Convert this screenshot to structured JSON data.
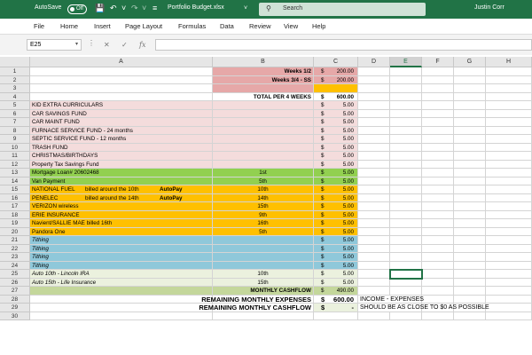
{
  "titlebar": {
    "autosave_label": "AutoSave",
    "autosave_state": "Off",
    "filename": "Portfolio Budget.xlsx",
    "search_label": "Search",
    "user": "Justin Corr"
  },
  "menu": [
    "File",
    "Home",
    "Insert",
    "Page Layout",
    "Formulas",
    "Data",
    "Review",
    "View",
    "Help"
  ],
  "formula_bar": {
    "name_box": "E25",
    "formula": ""
  },
  "columns": [
    "A",
    "B",
    "C",
    "D",
    "E",
    "F",
    "G",
    "H"
  ],
  "colors": {
    "header_red": "#e6a8a8",
    "pink": "#f4dcdc",
    "green": "#92d050",
    "orange": "#ffc000",
    "blue": "#8fc8da",
    "light_green": "#ebf1de",
    "olive": "#c4d79b",
    "excel_green": "#217346"
  },
  "rows": [
    {
      "n": "1",
      "a": "",
      "b": "Weeks 1/2",
      "c_dol": "$",
      "c_amt": "200.00",
      "style": "header"
    },
    {
      "n": "2",
      "a": "",
      "b": "Weeks 3/4 - SS",
      "c_dol": "$",
      "c_amt": "200.00",
      "style": "header"
    },
    {
      "n": "3",
      "a": "",
      "b": "",
      "c_dol": "",
      "c_amt": "",
      "style": "header_hidden"
    },
    {
      "n": "4",
      "a": "",
      "b": "TOTAL PER 4 WEEKS",
      "c_dol": "$",
      "c_amt": "600.00",
      "style": "total"
    },
    {
      "n": "5",
      "a": "KID EXTRA CURRICULARS",
      "b": "",
      "c_dol": "$",
      "c_amt": "5.00",
      "style": "pink"
    },
    {
      "n": "6",
      "a": "CAR SAVINGS FUND",
      "b": "",
      "c_dol": "$",
      "c_amt": "5.00",
      "style": "pink"
    },
    {
      "n": "7",
      "a": "CAR MAINT FUND",
      "b": "",
      "c_dol": "$",
      "c_amt": "5.00",
      "style": "pink"
    },
    {
      "n": "8",
      "a": "FURNACE SERVICE FUND - 24 months",
      "b": "",
      "c_dol": "$",
      "c_amt": "5.00",
      "style": "pink"
    },
    {
      "n": "9",
      "a": "SEPTIC SERVICE FUND - 12 months",
      "b": "",
      "c_dol": "$",
      "c_amt": "5.00",
      "style": "pink"
    },
    {
      "n": "10",
      "a": "TRASH FUND",
      "b": "",
      "c_dol": "$",
      "c_amt": "5.00",
      "style": "pink"
    },
    {
      "n": "11",
      "a": "CHRISTMAS/BIRTHDAYS",
      "b": "",
      "c_dol": "$",
      "c_amt": "5.00",
      "style": "pink"
    },
    {
      "n": "12",
      "a": "Property Tax Savings Fund",
      "b": "",
      "c_dol": "$",
      "c_amt": "5.00",
      "style": "pink"
    },
    {
      "n": "13",
      "a": "Mortgage    Loan# 20602468",
      "b": "1st",
      "c_dol": "$",
      "c_amt": "5.00",
      "style": "green"
    },
    {
      "n": "14",
      "a": "Van Payment",
      "b": "5th",
      "c_dol": "$",
      "c_amt": "5.00",
      "style": "green"
    },
    {
      "n": "15",
      "a": "NATIONAL FUEL",
      "a2": "billed around the 10th",
      "a3": "AutoPay",
      "b": "10th",
      "c_dol": "$",
      "c_amt": "5.00",
      "style": "orange"
    },
    {
      "n": "16",
      "a": "PENELEC",
      "a2": "billed around the 14th",
      "a3": "AutoPay",
      "b": "14th",
      "c_dol": "$",
      "c_amt": "5.00",
      "style": "orange"
    },
    {
      "n": "17",
      "a": "VERIZON wireless",
      "b": "15th",
      "c_dol": "$",
      "c_amt": "5.00",
      "style": "orange"
    },
    {
      "n": "18",
      "a": "ERIE INSURANCE",
      "b": "9th",
      "c_dol": "$",
      "c_amt": "5.00",
      "style": "orange"
    },
    {
      "n": "19",
      "a": "Navient/SALLIE MAE  billed 16th",
      "b": "16th",
      "c_dol": "$",
      "c_amt": "5.00",
      "style": "orange"
    },
    {
      "n": "20",
      "a": "Pandora One",
      "b": "5th",
      "c_dol": "$",
      "c_amt": "5.00",
      "style": "orange"
    },
    {
      "n": "21",
      "a": "Tithing",
      "b": "",
      "c_dol": "$",
      "c_amt": "5.00",
      "style": "blue"
    },
    {
      "n": "22",
      "a": "Tithing",
      "b": "",
      "c_dol": "$",
      "c_amt": "5.00",
      "style": "blue"
    },
    {
      "n": "23",
      "a": "Tithing",
      "b": "",
      "c_dol": "$",
      "c_amt": "5.00",
      "style": "blue"
    },
    {
      "n": "24",
      "a": "Tithing",
      "b": "",
      "c_dol": "$",
      "c_amt": "5.00",
      "style": "blue"
    },
    {
      "n": "25",
      "a": "Auto 10th  - Lincoln IRA",
      "b": "10th",
      "c_dol": "$",
      "c_amt": "5.00",
      "style": "lightgreen"
    },
    {
      "n": "26",
      "a": "Auto 15th - Life Insurance",
      "b": "15th",
      "c_dol": "$",
      "c_amt": "5.00",
      "style": "lightgreen"
    },
    {
      "n": "27",
      "a": "",
      "b": "MONTHLY CASHFLOW",
      "c_dol": "$",
      "c_amt": "490.00",
      "style": "cashflow"
    },
    {
      "n": "28",
      "a": "",
      "b": "REMAINING MONTHLY EXPENSES",
      "c_dol": "$",
      "c_amt": "600.00",
      "d": "INCOME - EXPENSES",
      "style": "remaining"
    },
    {
      "n": "29",
      "a": "",
      "b": "REMAINING MONTHLY CASHFLOW",
      "c_dol": "$",
      "c_amt": "-",
      "d": "SHOULD BE AS CLOSE TO $0 AS POSSIBLE",
      "style": "remaining2"
    },
    {
      "n": "30",
      "a": "",
      "b": "",
      "c_dol": "",
      "c_amt": "",
      "style": "blank"
    }
  ]
}
